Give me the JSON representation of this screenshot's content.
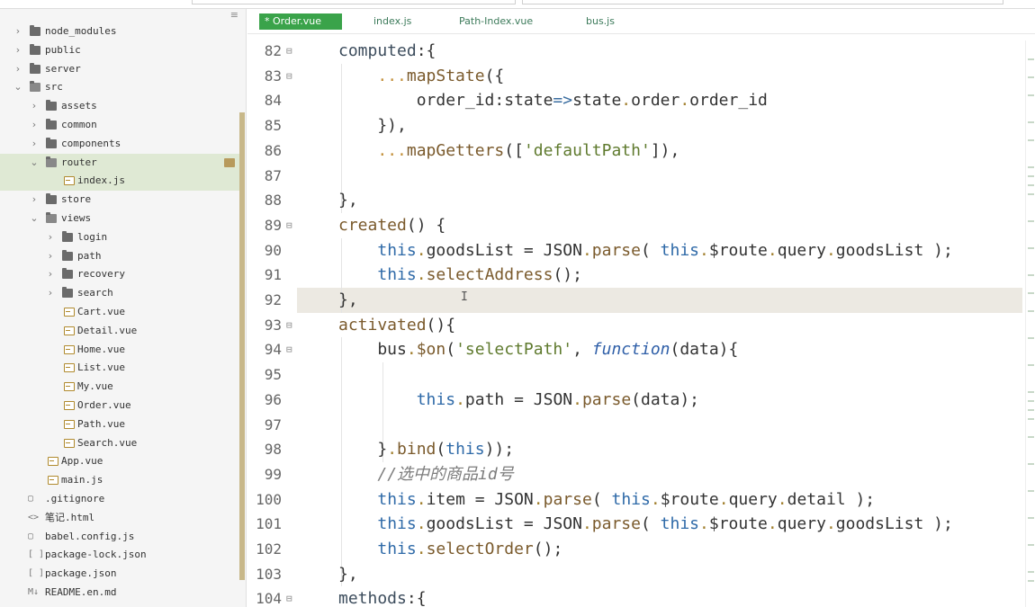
{
  "sidebar": {
    "tree": [
      {
        "label": "node_modules",
        "depth": 0,
        "kind": "folder",
        "expanded": false
      },
      {
        "label": "public",
        "depth": 0,
        "kind": "folder",
        "expanded": false
      },
      {
        "label": "server",
        "depth": 0,
        "kind": "folder",
        "expanded": false
      },
      {
        "label": "src",
        "depth": 0,
        "kind": "folder",
        "expanded": true
      },
      {
        "label": "assets",
        "depth": 1,
        "kind": "folder",
        "expanded": false
      },
      {
        "label": "common",
        "depth": 1,
        "kind": "folder",
        "expanded": false
      },
      {
        "label": "components",
        "depth": 1,
        "kind": "folder",
        "expanded": false
      },
      {
        "label": "router",
        "depth": 1,
        "kind": "folder",
        "expanded": true,
        "selected": true
      },
      {
        "label": "index.js",
        "depth": 2,
        "kind": "file",
        "selected": true
      },
      {
        "label": "store",
        "depth": 1,
        "kind": "folder",
        "expanded": false
      },
      {
        "label": "views",
        "depth": 1,
        "kind": "folder",
        "expanded": true
      },
      {
        "label": "login",
        "depth": 2,
        "kind": "folder",
        "expanded": false
      },
      {
        "label": "path",
        "depth": 2,
        "kind": "folder",
        "expanded": false
      },
      {
        "label": "recovery",
        "depth": 2,
        "kind": "folder",
        "expanded": false
      },
      {
        "label": "search",
        "depth": 2,
        "kind": "folder",
        "expanded": false
      },
      {
        "label": "Cart.vue",
        "depth": 2,
        "kind": "file"
      },
      {
        "label": "Detail.vue",
        "depth": 2,
        "kind": "file"
      },
      {
        "label": "Home.vue",
        "depth": 2,
        "kind": "file"
      },
      {
        "label": "List.vue",
        "depth": 2,
        "kind": "file"
      },
      {
        "label": "My.vue",
        "depth": 2,
        "kind": "file"
      },
      {
        "label": "Order.vue",
        "depth": 2,
        "kind": "file"
      },
      {
        "label": "Path.vue",
        "depth": 2,
        "kind": "file"
      },
      {
        "label": "Search.vue",
        "depth": 2,
        "kind": "file"
      },
      {
        "label": "App.vue",
        "depth": 1,
        "kind": "file"
      },
      {
        "label": "main.js",
        "depth": 1,
        "kind": "file"
      },
      {
        "label": ".gitignore",
        "depth": 0,
        "kind": "plain"
      },
      {
        "label": "笔记.html",
        "depth": 0,
        "kind": "html"
      },
      {
        "label": "babel.config.js",
        "depth": 0,
        "kind": "plain"
      },
      {
        "label": "package-lock.json",
        "depth": 0,
        "kind": "json"
      },
      {
        "label": "package.json",
        "depth": 0,
        "kind": "json"
      },
      {
        "label": "README.en.md",
        "depth": 0,
        "kind": "md"
      }
    ],
    "hamburger": "≡"
  },
  "tabs": [
    {
      "label": "* Order.vue",
      "active": true
    },
    {
      "label": "index.js",
      "active": false
    },
    {
      "label": "Path-Index.vue",
      "active": false
    },
    {
      "label": "bus.js",
      "active": false
    }
  ],
  "editor": {
    "highlighted_line": 92,
    "lines": [
      {
        "n": "82",
        "fold": "⊟",
        "code": "computed:{"
      },
      {
        "n": "83",
        "fold": "⊟",
        "code": "    ...mapState({"
      },
      {
        "n": "84",
        "fold": "",
        "code": "        order_id:state=>state.order.order_id"
      },
      {
        "n": "85",
        "fold": "",
        "code": "    }),"
      },
      {
        "n": "86",
        "fold": "",
        "code": "    ...mapGetters(['defaultPath']),"
      },
      {
        "n": "87",
        "fold": "",
        "code": ""
      },
      {
        "n": "88",
        "fold": "",
        "code": "},"
      },
      {
        "n": "89",
        "fold": "⊟",
        "code": "created() {"
      },
      {
        "n": "90",
        "fold": "",
        "code": "    this.goodsList = JSON.parse( this.$route.query.goodsList );"
      },
      {
        "n": "91",
        "fold": "",
        "code": "    this.selectAddress();"
      },
      {
        "n": "92",
        "fold": "",
        "code": "},"
      },
      {
        "n": "93",
        "fold": "⊟",
        "code": "activated(){"
      },
      {
        "n": "94",
        "fold": "⊟",
        "code": "    bus.$on('selectPath', function(data){"
      },
      {
        "n": "95",
        "fold": "",
        "code": ""
      },
      {
        "n": "96",
        "fold": "",
        "code": "        this.path = JSON.parse(data);"
      },
      {
        "n": "97",
        "fold": "",
        "code": ""
      },
      {
        "n": "98",
        "fold": "",
        "code": "    }.bind(this));"
      },
      {
        "n": "99",
        "fold": "",
        "code": "    //选中的商品id号"
      },
      {
        "n": "100",
        "fold": "",
        "code": "    this.item = JSON.parse( this.$route.query.detail );"
      },
      {
        "n": "101",
        "fold": "",
        "code": "    this.goodsList = JSON.parse( this.$route.query.goodsList );"
      },
      {
        "n": "102",
        "fold": "",
        "code": "    this.selectOrder();"
      },
      {
        "n": "103",
        "fold": "",
        "code": "},"
      },
      {
        "n": "104",
        "fold": "⊟",
        "code": "methods:{"
      }
    ]
  },
  "colors": {
    "active_tab": "#3aa34a",
    "selection": "#dfe9d4",
    "line_highlight": "#ece9e2",
    "keyword_this": "#2f6aa8"
  }
}
